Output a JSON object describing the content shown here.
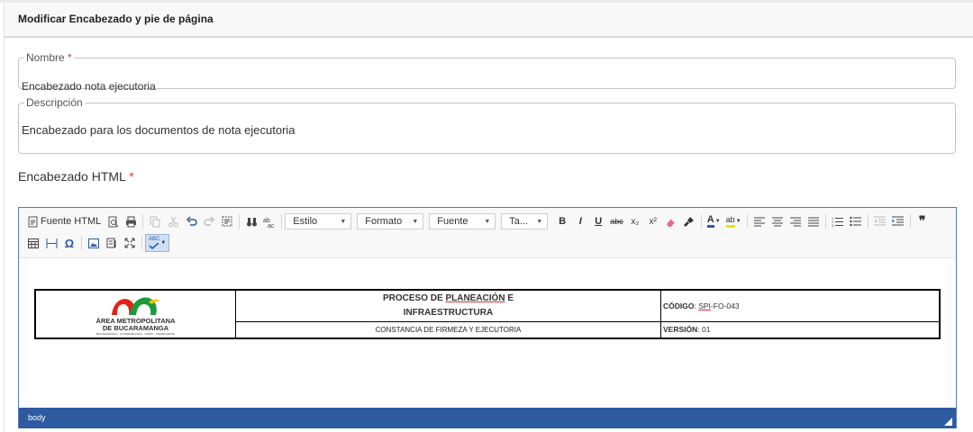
{
  "card": {
    "title": "Modificar Encabezado y pie de página"
  },
  "form": {
    "nombre": {
      "label": "Nombre",
      "required_mark": "*",
      "value": "Encabezado nota ejecutoria"
    },
    "descripcion": {
      "label": "Descripción",
      "value": "Encabezado para los documentos de nota ejecutoria"
    },
    "encabezado_html": {
      "label": "Encabezado HTML",
      "required_mark": "*"
    }
  },
  "editor": {
    "toolbar": {
      "source_label": "Fuente HTML",
      "combos": {
        "estilo": "Estilo",
        "formato": "Formato",
        "fuente": "Fuente",
        "tamano": "Ta..."
      },
      "bold": "B",
      "italic": "I",
      "underline": "U",
      "strike": "abc",
      "subscript": "x₂",
      "superscript": "x²",
      "text_color": "A",
      "bg_color": "ab",
      "blockquote": "❞",
      "special_char": "Ω",
      "spellcheck": "ABC"
    },
    "document": {
      "logo": {
        "line1": "ÁREA METROPOLITANA",
        "line2": "DE BUCARAMANGA",
        "line3": "BUCARAMANGA · FLORIDABLANCA · GIRÓN · PIEDECUESTA"
      },
      "title_line1_prefix": "PROCESO DE ",
      "title_line1_underlined": "PLANEACIÓN",
      "title_line1_suffix": " E",
      "title_line2": "INFRAESTRUCTURA",
      "subtitle": "CONSTANCIA DE FIRMEZA Y EJECUTORIA",
      "codigo_label": "CÓDIGO",
      "codigo_sep": ": ",
      "codigo_underlined": "SPI",
      "codigo_rest": "-FO-043",
      "version_label": "VERSIÓN",
      "version_value": ": 01"
    },
    "status": {
      "path": "body"
    }
  },
  "colors": {
    "accent": "#2e5aa0",
    "required": "#e53935",
    "logo_red": "#e2231a",
    "logo_green": "#1a9a3c",
    "logo_yellow": "#f2c400"
  }
}
